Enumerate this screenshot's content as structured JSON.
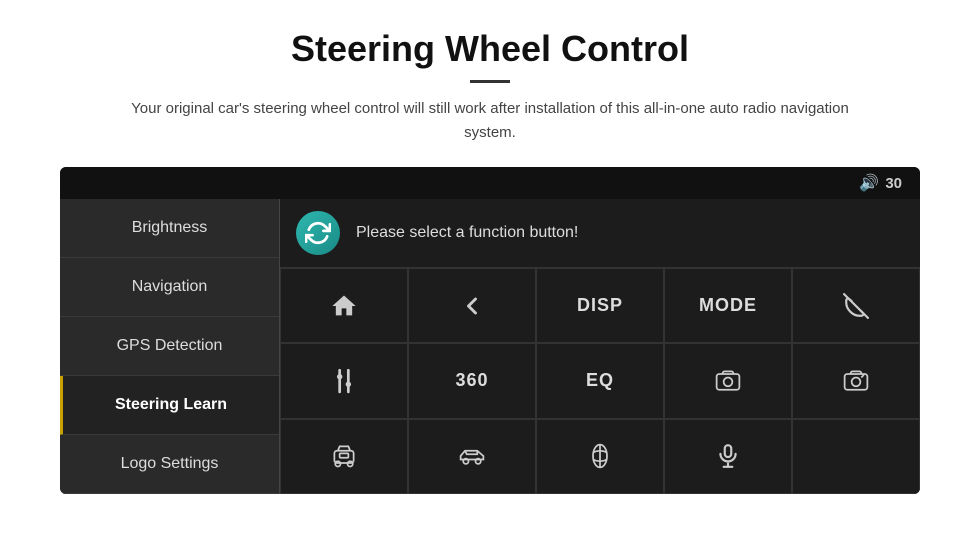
{
  "page": {
    "title": "Steering Wheel Control",
    "subtitle": "Your original car's steering wheel control will still work after installation of this all-in-one auto radio navigation system.",
    "divider": true
  },
  "topbar": {
    "volume_icon": "🔊",
    "volume_value": "30"
  },
  "sidebar": {
    "items": [
      {
        "label": "Brightness",
        "active": false
      },
      {
        "label": "Navigation",
        "active": false
      },
      {
        "label": "GPS Detection",
        "active": false
      },
      {
        "label": "Steering Learn",
        "active": true
      },
      {
        "label": "Logo Settings",
        "active": false
      }
    ]
  },
  "main": {
    "prompt": "Please select a function button!",
    "grid": [
      {
        "type": "icon",
        "icon": "home",
        "row": 1,
        "col": 1
      },
      {
        "type": "icon",
        "icon": "back",
        "row": 1,
        "col": 2
      },
      {
        "type": "label",
        "label": "DISP",
        "row": 1,
        "col": 3
      },
      {
        "type": "label",
        "label": "MODE",
        "row": 1,
        "col": 4
      },
      {
        "type": "icon",
        "icon": "phone-off",
        "row": 1,
        "col": 5
      },
      {
        "type": "icon",
        "icon": "tune",
        "row": 2,
        "col": 1
      },
      {
        "type": "label",
        "label": "360",
        "row": 2,
        "col": 2
      },
      {
        "type": "label",
        "label": "EQ",
        "row": 2,
        "col": 3
      },
      {
        "type": "icon",
        "icon": "cam1",
        "row": 2,
        "col": 4
      },
      {
        "type": "icon",
        "icon": "cam2",
        "row": 2,
        "col": 5
      },
      {
        "type": "icon",
        "icon": "car-front",
        "row": 3,
        "col": 1
      },
      {
        "type": "icon",
        "icon": "car-side",
        "row": 3,
        "col": 2
      },
      {
        "type": "icon",
        "icon": "car-top",
        "row": 3,
        "col": 3
      },
      {
        "type": "icon",
        "icon": "mic",
        "row": 3,
        "col": 4
      },
      {
        "type": "empty",
        "row": 3,
        "col": 5
      }
    ]
  }
}
